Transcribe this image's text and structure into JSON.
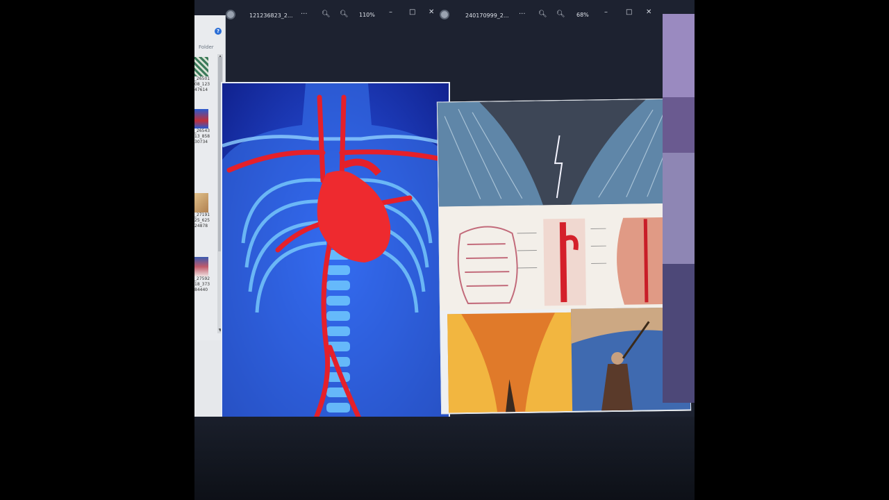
{
  "viewer_left": {
    "title": "121236823_2...",
    "more": "···",
    "zoom": "110%",
    "minimize": "–",
    "maximize": "□",
    "close": "✕"
  },
  "viewer_right": {
    "title": "240170999_2...",
    "more": "···",
    "zoom": "68%",
    "minimize": "–",
    "maximize": "□",
    "close": "✕"
  },
  "explorer": {
    "help": "?",
    "folder_label": "Folder",
    "thumbnails": [
      {
        "line1": "_26501",
        "line2": "08_123",
        "line3": "47614",
        "color": "#3b7a5a"
      },
      {
        "line1": "_26543",
        "line2": "13_858",
        "line3": "30734",
        "color": "#2a5bd0"
      },
      {
        "line1": "_27191",
        "line2": "25_625",
        "line3": "24878",
        "color": "#c8a070"
      },
      {
        "line1": "_27592",
        "line2": "18_373",
        "line3": "84440",
        "color": "#8a5060"
      }
    ]
  },
  "colors": {
    "screen_bg": "#1d2230",
    "anatomy_bg": "#1b3fd6",
    "artery_red": "#e5202a",
    "sea_blue": "#5f86a8"
  }
}
